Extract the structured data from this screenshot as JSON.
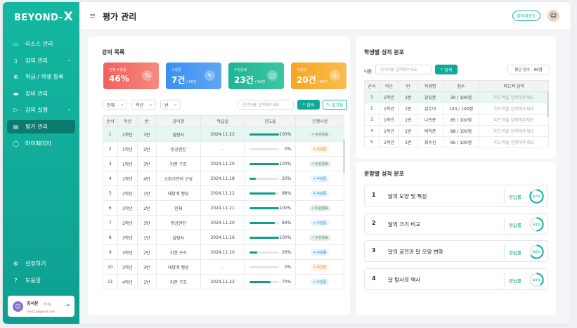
{
  "app": {
    "logo_text": "BEYOND-",
    "logo_x": "X",
    "page_title": "평가 관리",
    "guide_button": "강의자료도"
  },
  "sidebar": {
    "items": [
      {
        "label": "리소스 관리",
        "icon": "folder-icon"
      },
      {
        "label": "강의 관리",
        "icon": "book-icon",
        "chevron": "⌄"
      },
      {
        "label": "학급 / 학생 등록",
        "icon": "user-plus-icon"
      },
      {
        "label": "장비 관리",
        "icon": "device-icon"
      },
      {
        "label": "강의 실행",
        "icon": "play-icon",
        "chevron": "⌄"
      },
      {
        "label": "평가 관리",
        "icon": "clipboard-icon",
        "active": true
      },
      {
        "label": "마이페이지",
        "icon": "person-icon"
      }
    ],
    "bottom_items": [
      {
        "label": "설정하기",
        "icon": "settings-icon"
      },
      {
        "label": "도움말",
        "icon": "help-icon"
      }
    ],
    "user": {
      "name": "김서윤",
      "role": "강사님",
      "email": "kim123@gmail.com"
    }
  },
  "course_list": {
    "title": "강의 목록",
    "stats": [
      {
        "label": "전체 수강률",
        "value": "46%",
        "unit": "",
        "color": "#f0605f"
      },
      {
        "label": "수강중",
        "value": "7건",
        "unit": "/ 50건",
        "color": "#3d8ff0"
      },
      {
        "label": "수강완료",
        "value": "23건",
        "unit": "/ 50건",
        "color": "#1fb593"
      },
      {
        "label": "수강전",
        "value": "20건",
        "unit": "/ 50건",
        "color": "#f5a623"
      }
    ],
    "filters": {
      "all": "전체",
      "grade": "학년",
      "class": "반"
    },
    "search_placeholder": "검색어를 입력해주세요",
    "search_button": "검색",
    "reset_button": "초기화",
    "columns": [
      "순서",
      "학년",
      "반",
      "강의명",
      "학습일",
      "진도율",
      "진행사항"
    ],
    "rows": [
      {
        "no": "1",
        "grade": "1학년",
        "cls": "1반",
        "name": "달탐사",
        "date": "2024.11.22",
        "pct": "100%",
        "p": 100,
        "status": "수강완료",
        "kind": "done"
      },
      {
        "no": "2",
        "grade": "1학년",
        "cls": "2반",
        "name": "항공엔진",
        "date": "-",
        "pct": "0%",
        "p": 0,
        "status": "수강전",
        "kind": "pre"
      },
      {
        "no": "3",
        "grade": "1학년",
        "cls": "3반",
        "name": "지권 구조",
        "date": "2024.11.20",
        "pct": "100%",
        "p": 100,
        "status": "수강완료",
        "kind": "done"
      },
      {
        "no": "4",
        "grade": "1학년",
        "cls": "4반",
        "name": "소화기관의 구성",
        "date": "2024.11.18",
        "pct": "20%",
        "p": 20,
        "status": "수강중",
        "kind": "ing"
      },
      {
        "no": "5",
        "grade": "2학년",
        "cls": "1반",
        "name": "태양계 행성",
        "date": "2024.11.22",
        "pct": "88%",
        "p": 88,
        "status": "수강중",
        "kind": "ing"
      },
      {
        "no": "6",
        "grade": "2학년",
        "cls": "2반",
        "name": "인체",
        "date": "2024.11.21",
        "pct": "100%",
        "p": 100,
        "status": "수강완료",
        "kind": "done"
      },
      {
        "no": "7",
        "grade": "2학년",
        "cls": "3반",
        "name": "항공엔진",
        "date": "2024.11.20",
        "pct": "84%",
        "p": 84,
        "status": "수강중",
        "kind": "ing"
      },
      {
        "no": "8",
        "grade": "3학년",
        "cls": "1반",
        "name": "달탐사",
        "date": "2024.11.16",
        "pct": "100%",
        "p": 100,
        "status": "수강완료",
        "kind": "done"
      },
      {
        "no": "9",
        "grade": "3학년",
        "cls": "2반",
        "name": "지권 구조",
        "date": "2024.11.20",
        "pct": "26%",
        "p": 26,
        "status": "수강중",
        "kind": "ing"
      },
      {
        "no": "10",
        "grade": "3학년",
        "cls": "3반",
        "name": "태양계 행성",
        "date": "-",
        "pct": "0%",
        "p": 0,
        "status": "수강전",
        "kind": "pre"
      },
      {
        "no": "11",
        "grade": "4학년",
        "cls": "1반",
        "name": "지권 구조",
        "date": "2024.11.22",
        "pct": "70%",
        "p": 70,
        "status": "수강중",
        "kind": "ing"
      }
    ]
  },
  "student_scores": {
    "title": "학생별 성적 분포",
    "name_label": "이름",
    "search_placeholder": "검색어를 입력해주세요",
    "search_button": "검색",
    "average": "평균 점수 : 60점",
    "columns": [
      "순서",
      "학년",
      "반",
      "학생명",
      "점수",
      "피드백 입력"
    ],
    "feedback_placeholder": "피드백을 입력해주세요",
    "rows": [
      {
        "no": "1",
        "grade": "1학년",
        "cls": "1반",
        "name": "강유준",
        "score": "30 / 100점"
      },
      {
        "no": "2",
        "grade": "1학년",
        "cls": "1반",
        "name": "김수아",
        "score": "100 / 100점"
      },
      {
        "no": "3",
        "grade": "1학년",
        "cls": "1반",
        "name": "나민준",
        "score": "85 / 100점"
      },
      {
        "no": "4",
        "grade": "1학년",
        "cls": "1반",
        "name": "박하준",
        "score": "88 / 100점"
      },
      {
        "no": "5",
        "grade": "1학년",
        "cls": "1반",
        "name": "최수진",
        "score": "96 / 100점"
      }
    ]
  },
  "question_scores": {
    "title": "문항별 성적 분포",
    "rate_label": "정답률",
    "items": [
      {
        "no": "1",
        "title": "달의 모양 및 특징",
        "rate": "87%",
        "p": 87
      },
      {
        "no": "2",
        "title": "달의 크기 비교",
        "rate": "50%",
        "p": 50
      },
      {
        "no": "3",
        "title": "달의 공전과 달 모양 변화",
        "rate": "66%",
        "p": 66
      },
      {
        "no": "4",
        "title": "달 탐사의 역사",
        "rate": "40%",
        "p": 40
      }
    ]
  }
}
